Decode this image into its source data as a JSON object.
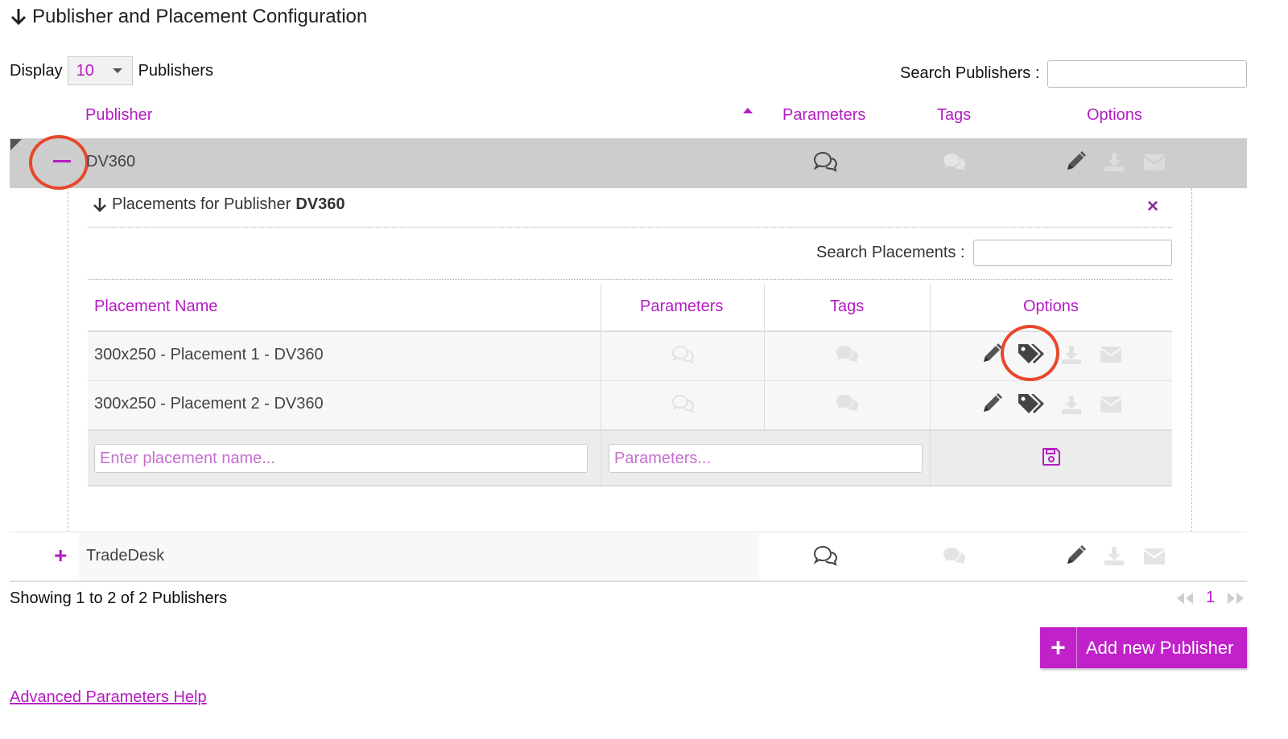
{
  "section": {
    "title": "Publisher and Placement Configuration"
  },
  "display": {
    "label": "Display",
    "value": "10",
    "suffix": "Publishers"
  },
  "search_publishers": {
    "label": "Search Publishers :",
    "value": ""
  },
  "publisher_table": {
    "columns": {
      "publisher": "Publisher",
      "parameters": "Parameters",
      "tags": "Tags",
      "options": "Options"
    },
    "rows": [
      {
        "name": "DV360",
        "expanded": true
      },
      {
        "name": "TradeDesk",
        "expanded": false
      }
    ]
  },
  "placements": {
    "title_prefix": "Placements for Publisher",
    "publisher": "DV360",
    "close": "×",
    "search_label": "Search Placements :",
    "columns": {
      "name": "Placement Name",
      "parameters": "Parameters",
      "tags": "Tags",
      "options": "Options"
    },
    "rows": [
      {
        "name": "300x250 - Placement 1 - DV360"
      },
      {
        "name": "300x250 - Placement 2 - DV360"
      }
    ],
    "new_name_placeholder": "Enter placement name...",
    "new_params_placeholder": "Parameters..."
  },
  "footer": {
    "showing": "Showing 1 to 2 of 2 Publishers",
    "page": "1",
    "add_button": "Add new Publisher",
    "help_link": "Advanced Parameters Help"
  },
  "icons": {
    "arrow": "arrow-down-icon",
    "comments": "comments-icon",
    "edit": "pencil-icon",
    "tag": "tags-icon",
    "download": "download-icon",
    "email": "envelope-icon",
    "save": "save-icon"
  },
  "colors": {
    "accent": "#b51cc4",
    "highlight_circle": "#e8472c",
    "selected_row": "#cdcdcd"
  }
}
